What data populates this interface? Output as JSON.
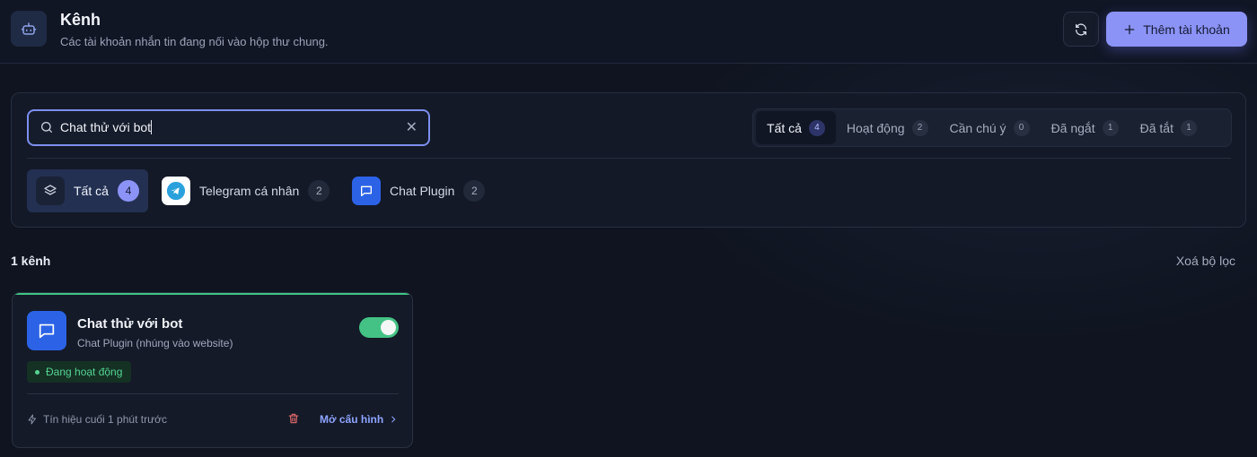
{
  "header": {
    "title": "Kênh",
    "subtitle": "Các tài khoản nhắn tin đang nối vào hộp thư chung.",
    "add_button": "Thêm tài khoản"
  },
  "search": {
    "value": "Chat thử với bot"
  },
  "status_tabs": [
    {
      "label": "Tất cả",
      "count": "4",
      "active": true
    },
    {
      "label": "Hoạt động",
      "count": "2"
    },
    {
      "label": "Cần chú ý",
      "count": "0"
    },
    {
      "label": "Đã ngắt",
      "count": "1"
    },
    {
      "label": "Đã tắt",
      "count": "1"
    }
  ],
  "platform_tabs": [
    {
      "label": "Tất cả",
      "count": "4",
      "active": true
    },
    {
      "label": "Telegram cá nhân",
      "count": "2"
    },
    {
      "label": "Chat Plugin",
      "count": "2"
    }
  ],
  "results": {
    "count_label": "1 kênh",
    "clear_filter": "Xoá bộ lọc"
  },
  "card": {
    "title": "Chat thử với bot",
    "subtitle": "Chat Plugin (nhúng vào website)",
    "status": "Đang hoạt động",
    "enabled": true,
    "signal": "Tín hiệu cuối 1 phút trước",
    "open_config": "Mở cấu hình"
  },
  "colors": {
    "accent": "#8b93f6",
    "active_green": "#44c285",
    "plugin_blue": "#2c63e6",
    "telegram_blue": "#2aa1dc",
    "danger": "#e26a6a"
  }
}
